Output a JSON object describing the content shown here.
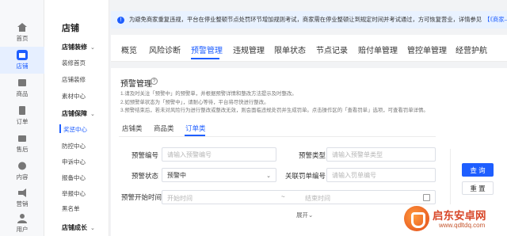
{
  "rail": [
    {
      "label": "首页",
      "icon": "home-icon"
    },
    {
      "label": "店铺",
      "icon": "shop-icon",
      "active": true
    },
    {
      "label": "商品",
      "icon": "goods-icon"
    },
    {
      "label": "订单",
      "icon": "order-icon"
    },
    {
      "label": "售后",
      "icon": "aftersale-icon"
    },
    {
      "label": "内容",
      "icon": "content-icon"
    },
    {
      "label": "营销",
      "icon": "marketing-icon"
    },
    {
      "label": "用户",
      "icon": "user-icon"
    }
  ],
  "submenu": {
    "title": "店铺",
    "groups": [
      {
        "label": "店铺装修",
        "caret": "⌄",
        "items": [
          "装修首页",
          "店铺装修",
          "素材中心"
        ]
      },
      {
        "label": "店铺保障",
        "caret": "⌄",
        "items": [
          "奖惩中心",
          "防控中心",
          "申诉中心",
          "报备中心",
          "举报中心",
          "黑名单"
        ]
      },
      {
        "label": "店铺成长",
        "caret": "⌄",
        "items": []
      }
    ]
  },
  "banner": {
    "text": "为避免商家重复违规，平台在停业整顿节点处罚环节增加规则考试，商家需在停业整顿让到规定时间并考试通过，方可恢复营业，详情参见",
    "link": "【《商家—停业整顿节点】"
  },
  "tabs": [
    "概览",
    "风险诊断",
    "预警管理",
    "违规管理",
    "限单状态",
    "节点记录",
    "赔付单管理",
    "管控单管理",
    "经营护航"
  ],
  "active_tab": "预警管理",
  "page": {
    "title": "预警管理",
    "help": "?",
    "notes": [
      "1.请及时关注「预警中」的预警单，并根据预警详情和整改方法提示及时整改。",
      "2.如预警单状态为「预警中」，请耐心等待，平台将尽快进行整改。",
      "3.预警结束后，若未对风险行为进行整改或整改无效，则会面临违规处罚并生成罚单。点击操作区的「查看罚单」选项，可查看罚单详情。"
    ]
  },
  "subtabs": [
    "店铺类",
    "商品类",
    "订单类"
  ],
  "active_subtab": "订单类",
  "form": {
    "warn_no": {
      "label": "预警编号",
      "placeholder": "请输入预警编号"
    },
    "warn_type": {
      "label": "预警类型",
      "placeholder": "请输入预警单类型"
    },
    "warn_status": {
      "label": "预警状态",
      "value": "预警中",
      "chevron": "⌄"
    },
    "penalty_no": {
      "label": "关联罚单编号",
      "placeholder": "请输入罚单编号"
    },
    "start_time": {
      "label": "预警开始时间",
      "start": "开始时间",
      "sep": "~",
      "end": "结束时间"
    },
    "expand": "展开⌄"
  },
  "buttons": {
    "query": "查 询",
    "reset": "重 置"
  },
  "watermark": {
    "name": "启东安卓网",
    "url": "www.qdltdq.com"
  },
  "colors": {
    "accent": "#1e5eff",
    "banner_bg": "#e9f2ff",
    "watermark": "#d8482a"
  }
}
